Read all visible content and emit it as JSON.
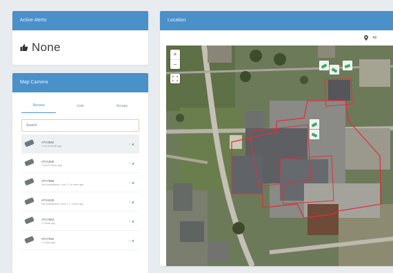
{
  "alerts": {
    "title": "Active Alerts",
    "value": "None"
  },
  "cameras": {
    "title": "Map Camera",
    "tabs": [
      "Neosee",
      "Lists",
      "Groups"
    ],
    "search_placeholder": "Search",
    "items": [
      {
        "name": "ATV4584",
        "desc": "1 Not Motorlift app",
        "status": "•· ◢"
      },
      {
        "name": "ATV1600",
        "desc": "1 Not 5 Chess app",
        "status": "•· ◢"
      },
      {
        "name": "ATV7958",
        "desc": "Not Ambassador: Line 1 2 le mem app",
        "status": "•· ◢"
      },
      {
        "name": "ATV2225",
        "desc": "Not Ambassador: Row 1, 1 Chess app",
        "status": "•· ◢"
      },
      {
        "name": "ATV7962",
        "desc": "1 Chess app",
        "status": "•· ◢"
      },
      {
        "name": "ATV7052",
        "desc": "1 Chess app",
        "status": "•· ◢"
      }
    ]
  },
  "location": {
    "title": "Location",
    "selected": "All",
    "zoom_in": "+",
    "zoom_out": "−"
  },
  "colors": {
    "header": "#4a90c9",
    "status_green": "#3fa66b",
    "zone_outline": "#e0303a"
  }
}
